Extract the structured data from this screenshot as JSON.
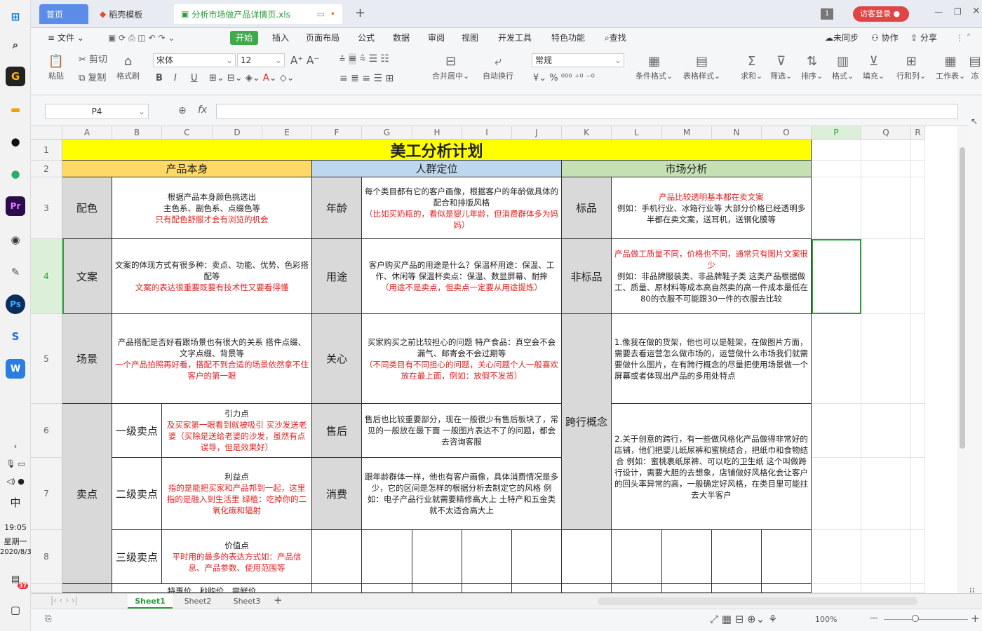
{
  "taskbar": {
    "time": "19:05",
    "weekday": "星期一",
    "date": "2020/8/3",
    "ime": "中",
    "badge": "37"
  },
  "tabs": {
    "home": "首页",
    "template": "稻壳模板",
    "file": "分析市场做产品详情页.xls"
  },
  "header": {
    "login": "访客登录",
    "page_num": "1"
  },
  "menu": {
    "file": "文件",
    "start": "开始",
    "insert": "插入",
    "layout": "页面布局",
    "formula": "公式",
    "data": "数据",
    "review": "审阅",
    "view": "视图",
    "dev": "开发工具",
    "special": "特色功能",
    "search": "查找",
    "sync": "未同步",
    "collab": "协作",
    "share": "分享"
  },
  "ribbon": {
    "paste": "粘贴",
    "cut": "剪切",
    "copy": "复制",
    "format_painter": "格式刷",
    "font": "宋体",
    "font_size": "12",
    "bold": "B",
    "italic": "I",
    "underline": "U",
    "merge": "合并居中",
    "wrap": "自动换行",
    "number_format": "常规",
    "cond_format": "条件格式",
    "table_style": "表格样式",
    "sum": "求和",
    "filter": "筛选",
    "sort": "排序",
    "format": "格式",
    "fill": "填充",
    "row_col": "行和列",
    "worksheet": "工作表",
    "more": "冻"
  },
  "formula": {
    "name_box": "P4",
    "fx": "fx",
    "content": ""
  },
  "columns": [
    "A",
    "B",
    "C",
    "D",
    "E",
    "F",
    "G",
    "H",
    "I",
    "J",
    "K",
    "L",
    "M",
    "N",
    "O",
    "P",
    "Q",
    "R"
  ],
  "rows": [
    "1",
    "2",
    "3",
    "4",
    "5",
    "6",
    "7",
    "8"
  ],
  "sheet": {
    "title": "美工分析计划",
    "sec1": "产品本身",
    "sec2": "人群定位",
    "sec3": "市场分析",
    "peise": "配色",
    "peise_t1": "根据产品本身颜色挑选出",
    "peise_t2": "主色系、副色系、点缀色等",
    "peise_r": "只有配色舒服才会有浏览的机会",
    "nianling": "年龄",
    "nianling_t": "每个类目都有它的客户画像，根据客户的年龄做具体的配合和排版风格",
    "nianling_r": "（比如买奶瓶的，看似是婴儿年龄，但消费群体多为妈妈）",
    "biaopin": "标品",
    "biaopin_r": "产品比较透明基本都在卖文案",
    "biaopin_t": "例如：手机行业、冰箱行业等 大部分价格已经透明多半都在卖文案，送耳机，送钢化膜等",
    "wenan": "文案",
    "wenan_t": "文案的体现方式有很多种：卖点、功能、优势、色彩搭配等",
    "wenan_r": "文案的表达很重要既要有技术性又要看得懂",
    "yongtu": "用途",
    "yongtu_t": "客户购买产品的用途是什么？保温杯用途：保温、工作、休闲等 保温杯卖点：保温、数显屏幕、耐摔",
    "yongtu_r": "（用途不是卖点，但卖点一定要从用途提炼）",
    "feibiao": "非标品",
    "feibiao_r": "产品做工质量不同，价格也不同，通常只有图片文案很少",
    "feibiao_t": "例如：非品牌服装类、非品牌鞋子类 这类产品根据做工、质量、原材料等成本高自然卖的高一件成本最低在80的衣服不可能跟30一件的衣服去比较",
    "changjing": "场景",
    "changjing_t": "产品搭配是否好看跟场景也有很大的关系 搭件点缀、文字点缀、背景等",
    "changjing_r": "一个产品拍照再好看，搭配不到合适的场景依然拿不住客户的第一眼",
    "guanxin": "关心",
    "guanxin_t": "买家购买之前比较担心的问题 特产食品：真空会不会漏气、邮寄会不会过期等",
    "guanxin_r": "（不同类目有不同担心的问题，关心问题个人一般喜欢放在最上面，例如：放假不发货）",
    "kuahang_t1": "1.像我在做的货架，他也可以是鞋架，在做图片方面，需要去看运营怎么做市场的，运营做什么市场我们就需要做什么图片，在有跨行概念的尽量把使用场景做一个屏幕或者体现出产品的多用处特点",
    "maidian": "卖点",
    "yiji": "一级卖点",
    "yiji_t": "引力点",
    "yiji_r": "及买家第一眼看到就被吸引 买沙发送老婆（买除是送给老婆的沙发，虽然有点误导，但是效果好）",
    "shouhou": "售后",
    "shouhou_t": "售后也比较重要部分，现在一般很少有售后板块了，常见的一般放在最下面 一般图片表达不了的问题，都会去咨询客服",
    "kuahang": "跨行概念",
    "kuahang_t2": "2.关于创意的跨行，有一些做风格化产品做得非常好的店铺，他们把婴儿纸尿裤和蜜桃结合，把纸巾和食物结合 例如：蜜桃裹纸尿裤、可以吃的卫生纸 这个叫做跨行设计，需要大胆的去想象，店铺做好风格化会让客户的回头率异常的高，一般确定好风格，在类目里可能拄去大半客户",
    "erji": "二级卖点",
    "erji_t": "利益点",
    "erji_r": "指的是能把买家和产品邦到一起，这里指的是融入到生活里 绿植：吃掉你的二氧化碳和辐射",
    "xiaofei": "消费",
    "xiaofei_t": "跟年龄群体一样，他也有客户画像，具体消费情况是多少，它的区间是怎样的根据分析去制定它的风格 例如：电子产品行业就需要精修高大上 土特产和五金类就不太适合高大上",
    "sanji": "三级卖点",
    "sanji_t": "价值点",
    "sanji_r": "平时用的最多的表达方式如：产品信息、产品参数、使用范围等",
    "row9_partial": "特惠价、秒购价、尝鲜价"
  },
  "sheets": [
    "Sheet1",
    "Sheet2",
    "Sheet3"
  ],
  "status": {
    "zoom": "100%"
  }
}
